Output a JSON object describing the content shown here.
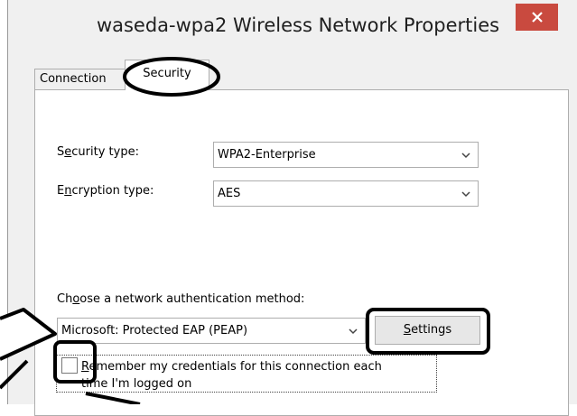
{
  "window": {
    "title": "waseda-wpa2 Wireless Network Properties",
    "close_glyph": "✕"
  },
  "tabs": [
    {
      "label": "Connection",
      "selected": false
    },
    {
      "label": "Security",
      "selected": true
    }
  ],
  "security_type": {
    "label_pre": "S",
    "label_accel": "e",
    "label_post": "curity type:",
    "value": "WPA2-Enterprise"
  },
  "encryption_type": {
    "label_pre": "E",
    "label_accel": "n",
    "label_post": "cryption type:",
    "value": "AES"
  },
  "auth_method": {
    "label_pre": "Ch",
    "label_accel": "o",
    "label_post": "ose a network authentication method:",
    "value": "Microsoft: Protected EAP (PEAP)"
  },
  "settings_button": {
    "accel": "S",
    "rest": "ettings"
  },
  "remember": {
    "checked": false,
    "line1_accel": "R",
    "line1_rest": "emember my credentials for this connection each",
    "line2": "time I'm logged on"
  },
  "icons": {
    "dropdown": "chevron-down-icon",
    "close": "close-icon"
  }
}
